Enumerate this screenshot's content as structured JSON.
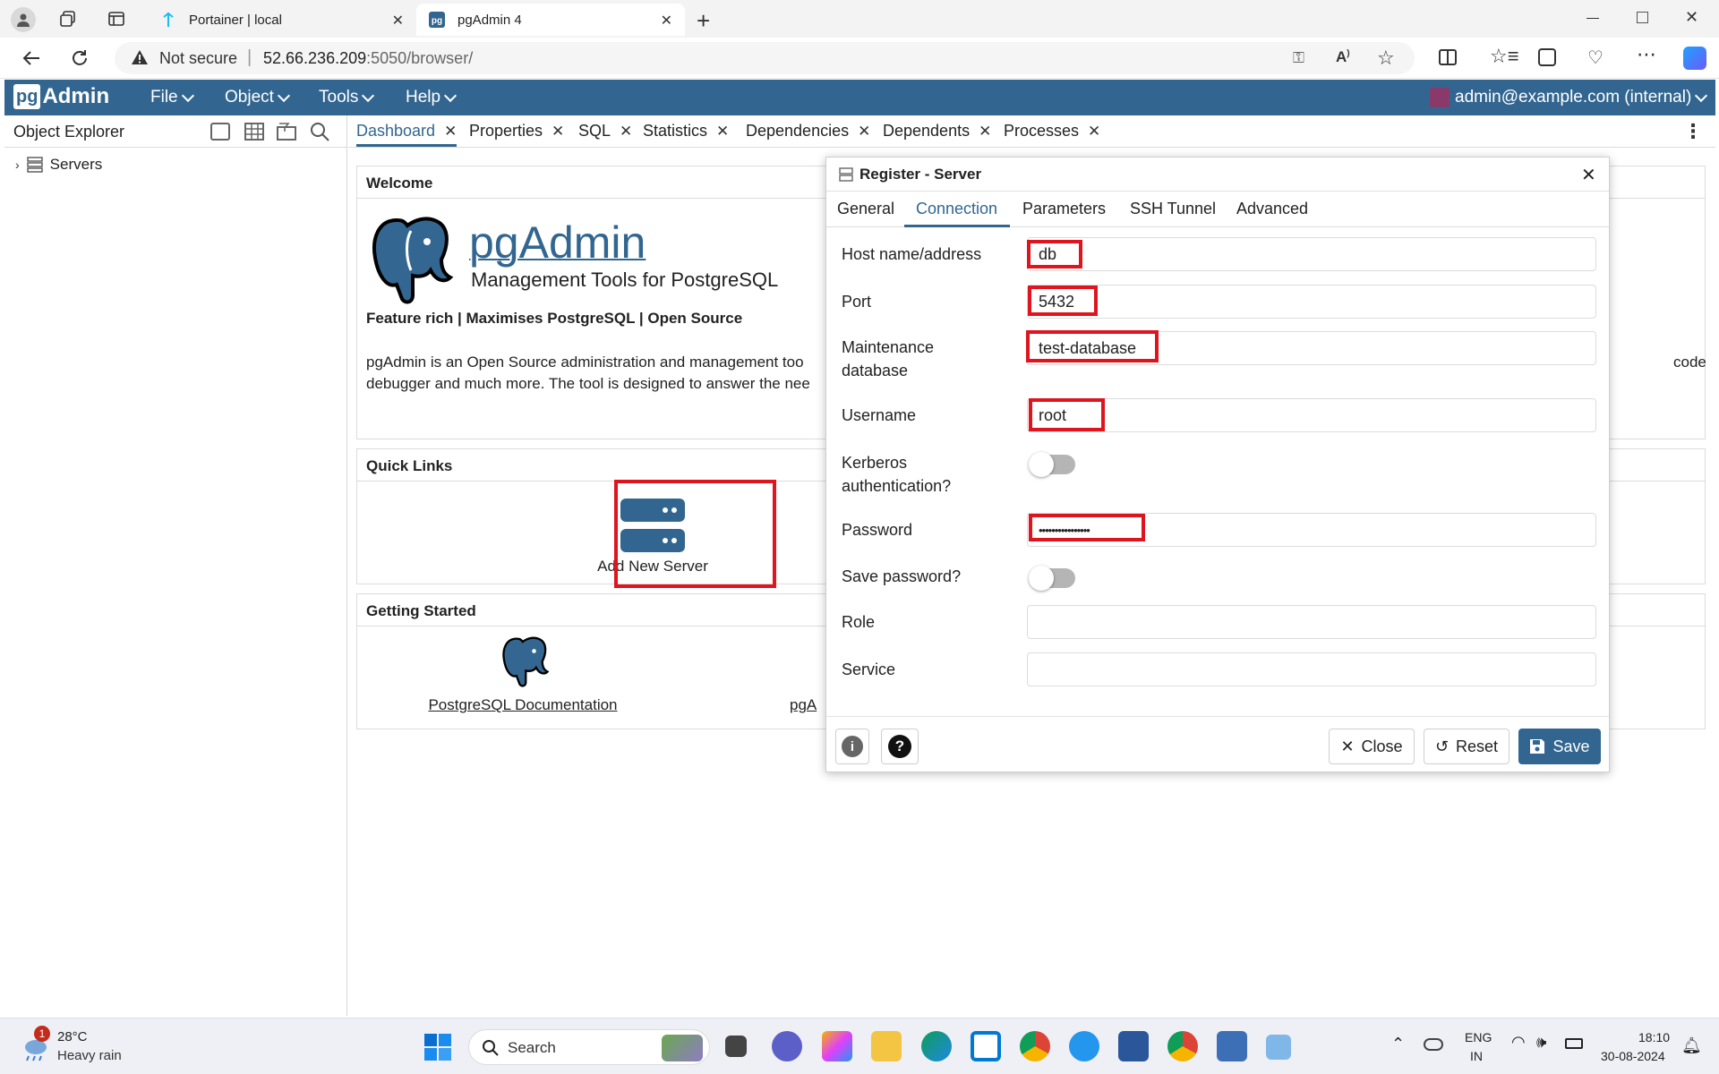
{
  "browser": {
    "tabs": [
      {
        "title": "Portainer | local"
      },
      {
        "title": "pgAdmin 4"
      }
    ],
    "security_label": "Not secure",
    "url_host": "52.66.236.209",
    "url_rest": ":5050/browser/"
  },
  "pgadmin": {
    "logo_text": "pgAdmin",
    "menu": [
      "File",
      "Object",
      "Tools",
      "Help"
    ],
    "user": "admin@example.com (internal)",
    "object_explorer_title": "Object Explorer",
    "tree": [
      {
        "label": "Servers"
      }
    ],
    "main_tabs": [
      "Dashboard",
      "Properties",
      "SQL",
      "Statistics",
      "Dependencies",
      "Dependents",
      "Processes"
    ],
    "welcome": {
      "header": "Welcome",
      "title": "pgAdmin",
      "subtitle": "Management Tools for PostgreSQL",
      "tagline": "Feature rich | Maximises PostgreSQL | Open Source",
      "description_line1": "pgAdmin is an Open Source administration and management too",
      "description_line2": "debugger and much more. The tool is designed to answer the nee",
      "description_tail": "code"
    },
    "quick_links": {
      "header": "Quick Links",
      "add_server": "Add New Server"
    },
    "getting_started": {
      "header": "Getting Started",
      "pg_docs": "PostgreSQL Documentation",
      "pga_partial": "pgA"
    }
  },
  "dialog": {
    "title": "Register - Server",
    "tabs": [
      "General",
      "Connection",
      "Parameters",
      "SSH Tunnel",
      "Advanced"
    ],
    "active_tab": "Connection",
    "fields": {
      "host_label": "Host name/address",
      "host_value": "db",
      "port_label": "Port",
      "port_value": "5432",
      "maint_label_1": "Maintenance",
      "maint_label_2": "database",
      "maint_value": "test-database",
      "username_label": "Username",
      "username_value": "root",
      "kerberos_label_1": "Kerberos",
      "kerberos_label_2": "authentication?",
      "kerberos_on": false,
      "password_label": "Password",
      "password_value": "••••••••••••••••",
      "save_password_label": "Save password?",
      "save_password_on": false,
      "role_label": "Role",
      "role_value": "",
      "service_label": "Service",
      "service_value": ""
    },
    "buttons": {
      "close": "Close",
      "reset": "Reset",
      "save": "Save"
    }
  },
  "taskbar": {
    "weather_temp": "28°C",
    "weather_desc": "Heavy rain",
    "weather_badge": "1",
    "search_placeholder": "Search",
    "lang_1": "ENG",
    "lang_2": "IN",
    "time": "18:10",
    "date": "30-08-2024"
  },
  "colors": {
    "pg_blue": "#326690",
    "highlight_red": "#e0141e",
    "save_button": "#326690"
  }
}
